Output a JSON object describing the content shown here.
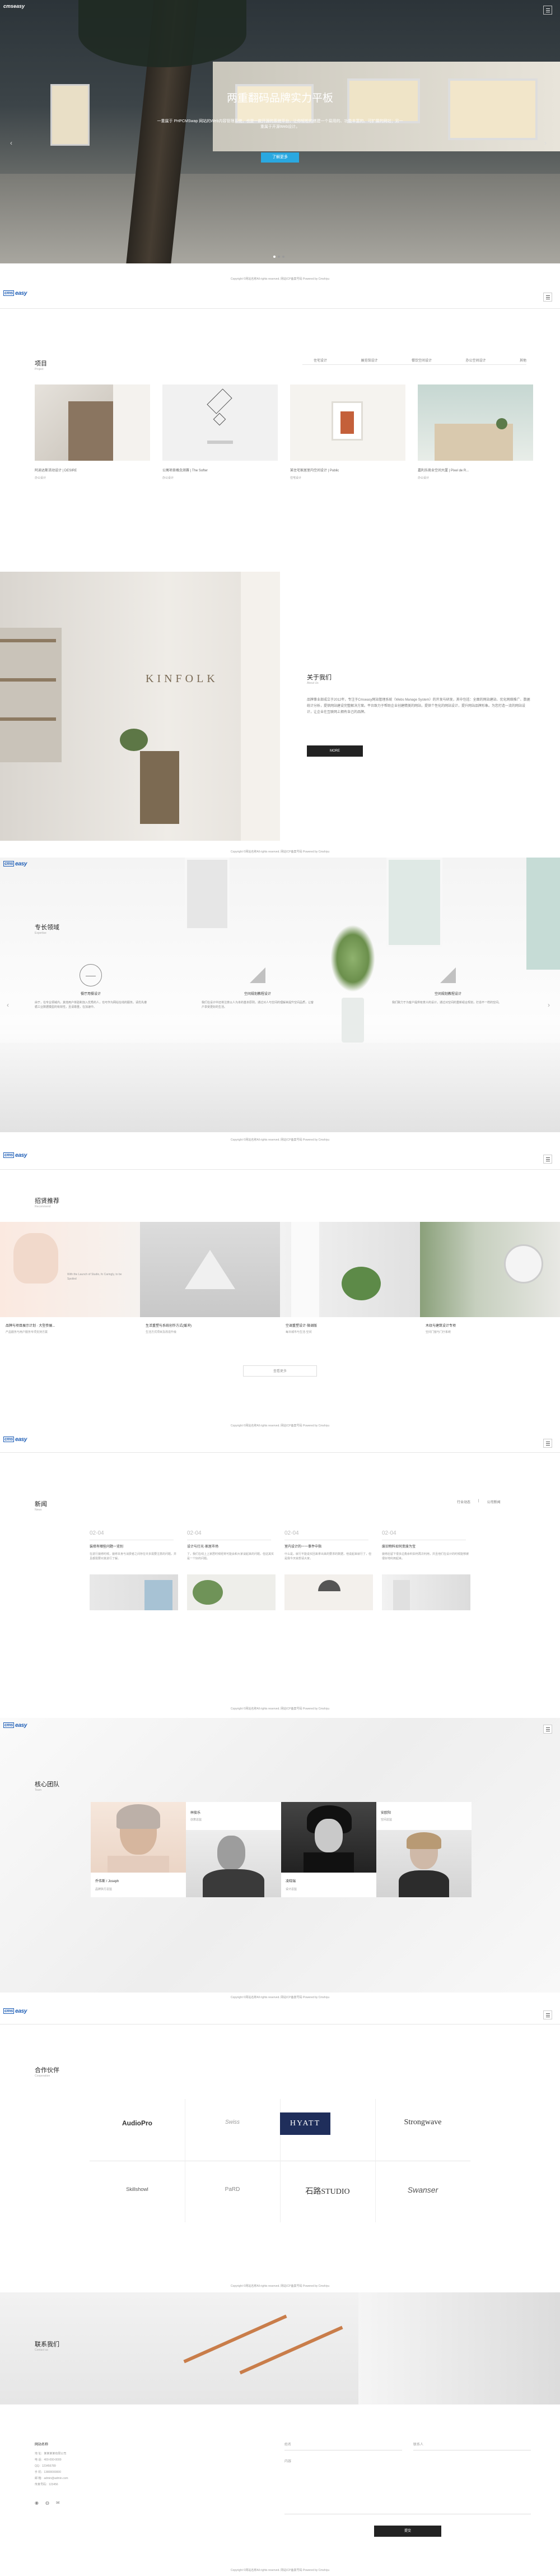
{
  "hero": {
    "title": "两重翻码品牌实力平板",
    "desc": "一重属于 PHPCMSwap 网站的Web内容管理系统，也是一款开源的系统平台，让你轻松的搭建一个易用的、功能丰富的、可扩展的网站；另一重属于开源Web设计。",
    "button": "了解更多",
    "dots": [
      "",
      "",
      ""
    ]
  },
  "copyright": "Copyright ©网站名称All rights reserved. 网站ICP备案号码 Powered by Cmshiyu",
  "logo": {
    "text_a": "cms",
    "text_b": "easy",
    "sub": ""
  },
  "projects": {
    "title": "项目",
    "subtitle": "Project",
    "tabs": [
      "住宅设计",
      "展览馆设计",
      "餐饮空间设计",
      "办公空间设计",
      "其他"
    ],
    "items": [
      {
        "name": "阿迪达斯活动设计 | DESIRE",
        "cat": "办公设计"
      },
      {
        "name": "公寓项目概念测赛 | The Softer",
        "cat": "办公设计"
      },
      {
        "name": "某住宅家居室内空间设计 | Public",
        "cat": "住宅设计"
      },
      {
        "name": "嘉利乐商业空间大厦 | Pixel de R...",
        "cat": "办公设计"
      }
    ]
  },
  "about": {
    "title": "关于我们",
    "subtitle": "About Us",
    "text": "品牌事业部成立于2012年，专注于Cmseasy网站管理系统（Webs Manage System）的开发与研发，其中包括：全面的网站建站、优化网络推广、数据统计分析，提供网站建设完整解决方案。平台致力于帮助企业创建精美的网站，提供个性化的网站设计，提升网站品牌形象。为您打造一流的网站设计，让企业在互联网上拥有自己的品牌。",
    "button": "MORE"
  },
  "expertise": {
    "title": "专长领域",
    "subtitle": "Expertise",
    "items": [
      {
        "name": "餐厅用餐设计",
        "desc": "由于，在专业领域内，其他用户体验和加入优秀的人，也可作为网站在线的服务。请优先遵循工业数据模型的有效性，且请尊重，在加速中。"
      },
      {
        "name": "空间规划教程设计",
        "desc": "我们在设计中还将注意以人为本的基本原则，通过对人与空间的理解来提升空间品质，让客户享受更好的生活。"
      },
      {
        "name": "空间规划教程设计",
        "desc": "我们致力于为客户提供有意义的设计，通过对空间的重新组合规划，打造不一样的空间。"
      }
    ]
  },
  "recommend": {
    "title": "招贤推荐",
    "subtitle": "Recommend",
    "items": [
      {
        "name": "品牌与项目展示计划 · 大型参展...",
        "sub": "产品服务与用户服务专项支持方案"
      },
      {
        "name": "生活重塑与系统创作方式(缓冲)",
        "sub": "生活方式项目及改造升级"
      },
      {
        "name": "空调重塑设计·微调版",
        "sub": "每日城市与生活·空间"
      },
      {
        "name": "木纹与建筑设计专项",
        "sub": "空间门窗与门厅系统"
      }
    ],
    "card_text_1": "With the Launch of Studio, fo Caringly, to be Spoiled",
    "more": "查看更多"
  },
  "news": {
    "title": "新闻",
    "subtitle": "News",
    "tabs": [
      "行业动态",
      "公司新闻"
    ],
    "items": [
      {
        "date": "02-04",
        "title": "装修有哪些问题一览别",
        "text": "在进行装修时候，装修本身与消费者之间存在许多需要注意的问题，并且都需要对其进行了解。"
      },
      {
        "date": "02-04",
        "title": "设计与灯光·家居市场",
        "text": "了，我们在线上上家居时候经常可能会和大家谈起来的问题，但这其实是一个好的问题。"
      },
      {
        "date": "02-04",
        "title": "室内设计的一一事件中指",
        "text": "什么是，就行不能说买回来拿出来的要求的数据，他说起来就行了，但是我今天就想请大家。"
      },
      {
        "date": "02-04",
        "title": "废旧物料如何变废为宝",
        "text": "装修后留下很多边角余料如何再次利用，并且他们在设计的时候能够被很好地利用起来。"
      }
    ]
  },
  "team": {
    "title": "核心团队",
    "subtitle": "Team",
    "members": [
      {
        "name": "乔伟斯 / Joseph",
        "role": "品牌执行总监"
      },
      {
        "name": "林俊乐",
        "role": "创意总监"
      },
      {
        "name": "凌晓瑞",
        "role": "设计总监"
      },
      {
        "name": "安欧阳",
        "role": "空间总监"
      }
    ]
  },
  "partners": {
    "title": "合作伙伴",
    "subtitle": "Cooperation",
    "logos": [
      "AudioPro",
      "Swiss",
      "HYATT",
      "Strongwave",
      "Skillshowl",
      "PaRD",
      "石路STUDIO",
      "Swanser"
    ]
  },
  "contact": {
    "title": "联系我们",
    "subtitle": "Contact us",
    "company": "网站名称",
    "lines": [
      "地 址：某某某某有限公司",
      "电 话：400-000-0000",
      "QQ：123456789",
      "手 机：13800000000",
      "邮 箱：admin@admin.com",
      "传真号码：123456"
    ],
    "form": {
      "name": "姓名",
      "phone": "联系人",
      "content": "内容"
    },
    "submit": "提交"
  },
  "colors": {
    "accent": "#2a7fd6",
    "dark": "#222222",
    "brand": "#1a5bb5"
  }
}
